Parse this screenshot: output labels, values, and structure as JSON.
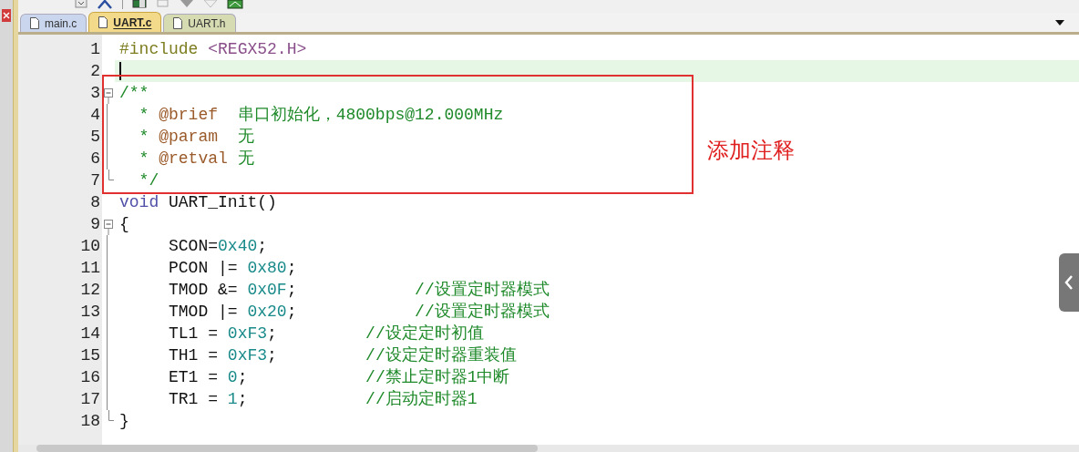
{
  "tabs": [
    {
      "label": "main.c",
      "selected": false,
      "color": "#c9d6ee"
    },
    {
      "label": "UART.c",
      "selected": true,
      "color": "#f3d98a"
    },
    {
      "label": "UART.h",
      "selected": false,
      "color": "#d6dbb2"
    }
  ],
  "editor": {
    "lines": [
      {
        "number": "1",
        "current": false,
        "fold_start": false,
        "fold_end": false,
        "segments": [
          {
            "kind": "preproc",
            "text": "#include"
          },
          {
            "kind": "string",
            "text": " <REGX52.H>"
          }
        ]
      },
      {
        "number": "2",
        "current": true,
        "fold_start": false,
        "fold_end": false
      },
      {
        "number": "3",
        "current": false,
        "fold_start": true,
        "fold_end": false,
        "segments": [
          {
            "kind": "comment",
            "text": "/**"
          }
        ]
      },
      {
        "number": "4",
        "current": false,
        "fold_start": false,
        "fold_end": false,
        "segments": [
          {
            "kind": "comment",
            "text": "  * "
          },
          {
            "kind": "doctag",
            "text": "@brief"
          },
          {
            "kind": "comment",
            "text": "  串口初始化，4800bps@12.000MHz"
          }
        ]
      },
      {
        "number": "5",
        "current": false,
        "fold_start": false,
        "fold_end": false,
        "segments": [
          {
            "kind": "comment",
            "text": "  * "
          },
          {
            "kind": "doctag",
            "text": "@param"
          },
          {
            "kind": "comment",
            "text": "  无"
          }
        ]
      },
      {
        "number": "6",
        "current": false,
        "fold_start": false,
        "fold_end": false,
        "segments": [
          {
            "kind": "comment",
            "text": "  * "
          },
          {
            "kind": "doctag",
            "text": "@retval"
          },
          {
            "kind": "comment",
            "text": " 无"
          }
        ]
      },
      {
        "number": "7",
        "current": false,
        "fold_start": false,
        "fold_end": true,
        "segments": [
          {
            "kind": "comment",
            "text": "  */"
          }
        ]
      },
      {
        "number": "8",
        "current": false,
        "fold_start": false,
        "fold_end": false,
        "segments": [
          {
            "kind": "keyword",
            "text": "void"
          },
          {
            "kind": "plain",
            "text": " UART_Init()"
          }
        ]
      },
      {
        "number": "9",
        "current": false,
        "fold_start": true,
        "fold_end": false,
        "segments": [
          {
            "kind": "plain",
            "text": "{"
          }
        ]
      },
      {
        "number": "10",
        "current": false,
        "fold_start": false,
        "fold_end": false,
        "segments": [
          {
            "kind": "plain",
            "text": "     SCON="
          },
          {
            "kind": "number",
            "text": "0x40"
          },
          {
            "kind": "plain",
            "text": ";"
          }
        ]
      },
      {
        "number": "11",
        "current": false,
        "fold_start": false,
        "fold_end": false,
        "segments": [
          {
            "kind": "plain",
            "text": "     PCON |= "
          },
          {
            "kind": "number",
            "text": "0x80"
          },
          {
            "kind": "plain",
            "text": ";"
          }
        ]
      },
      {
        "number": "12",
        "current": false,
        "fold_start": false,
        "fold_end": false,
        "segments": [
          {
            "kind": "plain",
            "text": "     TMOD &= "
          },
          {
            "kind": "number",
            "text": "0x0F"
          },
          {
            "kind": "plain",
            "text": ";            "
          },
          {
            "kind": "comment",
            "text": "//设置定时器模式"
          }
        ]
      },
      {
        "number": "13",
        "current": false,
        "fold_start": false,
        "fold_end": false,
        "segments": [
          {
            "kind": "plain",
            "text": "     TMOD |= "
          },
          {
            "kind": "number",
            "text": "0x20"
          },
          {
            "kind": "plain",
            "text": ";            "
          },
          {
            "kind": "comment",
            "text": "//设置定时器模式"
          }
        ]
      },
      {
        "number": "14",
        "current": false,
        "fold_start": false,
        "fold_end": false,
        "segments": [
          {
            "kind": "plain",
            "text": "     TL1 = "
          },
          {
            "kind": "number",
            "text": "0xF3"
          },
          {
            "kind": "plain",
            "text": ";         "
          },
          {
            "kind": "comment",
            "text": "//设定定时初值"
          }
        ]
      },
      {
        "number": "15",
        "current": false,
        "fold_start": false,
        "fold_end": false,
        "segments": [
          {
            "kind": "plain",
            "text": "     TH1 = "
          },
          {
            "kind": "number",
            "text": "0xF3"
          },
          {
            "kind": "plain",
            "text": ";         "
          },
          {
            "kind": "comment",
            "text": "//设定定时器重装值"
          }
        ]
      },
      {
        "number": "16",
        "current": false,
        "fold_start": false,
        "fold_end": false,
        "segments": [
          {
            "kind": "plain",
            "text": "     ET1 = "
          },
          {
            "kind": "number",
            "text": "0"
          },
          {
            "kind": "plain",
            "text": ";            "
          },
          {
            "kind": "comment",
            "text": "//禁止定时器1中断"
          }
        ]
      },
      {
        "number": "17",
        "current": false,
        "fold_start": false,
        "fold_end": false,
        "segments": [
          {
            "kind": "plain",
            "text": "     TR1 = "
          },
          {
            "kind": "number",
            "text": "1"
          },
          {
            "kind": "plain",
            "text": ";            "
          },
          {
            "kind": "comment",
            "text": "//启动定时器1"
          }
        ]
      },
      {
        "number": "18",
        "current": false,
        "fold_start": false,
        "fold_end": true,
        "segments": [
          {
            "kind": "plain",
            "text": "}"
          }
        ]
      }
    ]
  },
  "annotation": {
    "text": "添加注释"
  }
}
